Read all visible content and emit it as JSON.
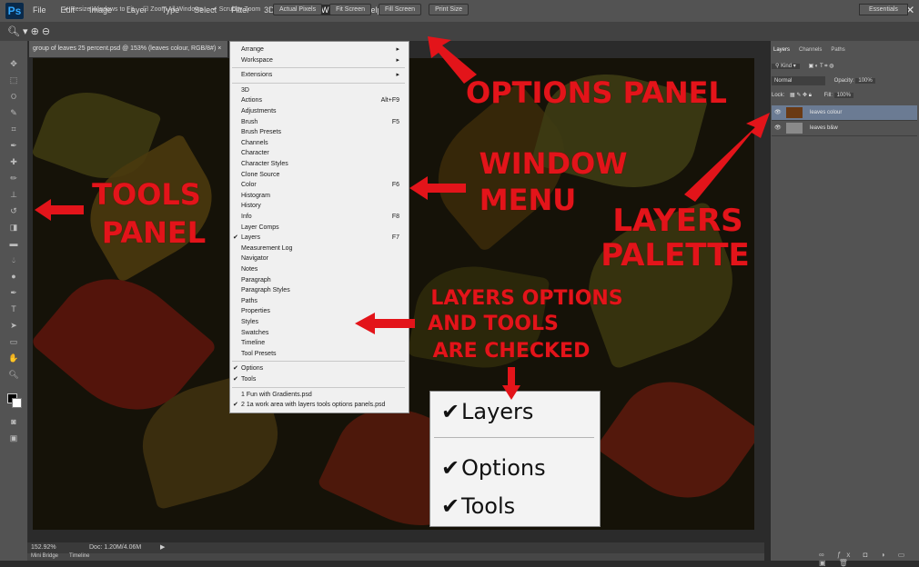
{
  "app": {
    "logo": "Ps",
    "menu": [
      "File",
      "Edit",
      "Image",
      "Layer",
      "Type",
      "Select",
      "Filter",
      "3D",
      "View",
      "Window",
      "Help"
    ],
    "active_menu": "Window",
    "window_controls": [
      "–",
      "⧉",
      "✕"
    ]
  },
  "options_bar": {
    "checks": [
      "Resize Windows to Fit",
      "Zoom All Windows",
      "Scrubby Zoom"
    ],
    "buttons": [
      "Actual Pixels",
      "Fit Screen",
      "Fill Screen",
      "Print Size"
    ],
    "workspace": "Essentials"
  },
  "document": {
    "tab_title": "group of leaves 25 percent.psd @ 153% (leaves colour, RGB/8#) ×",
    "zoom_status": "152.92%",
    "doc_status": "Doc: 1.20M/4.06M",
    "bottom_tabs": [
      "Mini Bridge",
      "Timeline"
    ]
  },
  "layers_panel": {
    "tabs": [
      "Layers",
      "Channels",
      "Paths"
    ],
    "kind_label": "Kind",
    "blend_mode": "Normal",
    "opacity_label": "Opacity:",
    "opacity_value": "100%",
    "lock_label": "Lock:",
    "fill_label": "Fill:",
    "fill_value": "100%",
    "layers": [
      {
        "name": "leaves colour",
        "selected": true
      },
      {
        "name": "leaves b&w",
        "selected": false
      }
    ]
  },
  "window_menu": {
    "items": [
      {
        "label": "Arrange",
        "submenu": true
      },
      {
        "label": "Workspace",
        "submenu": true
      },
      {
        "sep": true
      },
      {
        "label": "Extensions",
        "submenu": true
      },
      {
        "sep": true
      },
      {
        "label": "3D"
      },
      {
        "label": "Actions",
        "shortcut": "Alt+F9"
      },
      {
        "label": "Adjustments"
      },
      {
        "label": "Brush",
        "shortcut": "F5"
      },
      {
        "label": "Brush Presets"
      },
      {
        "label": "Channels"
      },
      {
        "label": "Character"
      },
      {
        "label": "Character Styles"
      },
      {
        "label": "Clone Source"
      },
      {
        "label": "Color",
        "shortcut": "F6"
      },
      {
        "label": "Histogram"
      },
      {
        "label": "History"
      },
      {
        "label": "Info",
        "shortcut": "F8"
      },
      {
        "label": "Layer Comps"
      },
      {
        "label": "Layers",
        "shortcut": "F7",
        "checked": true
      },
      {
        "label": "Measurement Log"
      },
      {
        "label": "Navigator"
      },
      {
        "label": "Notes"
      },
      {
        "label": "Paragraph"
      },
      {
        "label": "Paragraph Styles"
      },
      {
        "label": "Paths"
      },
      {
        "label": "Properties"
      },
      {
        "label": "Styles"
      },
      {
        "label": "Swatches"
      },
      {
        "label": "Timeline"
      },
      {
        "label": "Tool Presets"
      },
      {
        "sep": true
      },
      {
        "label": "Options",
        "checked": true
      },
      {
        "label": "Tools",
        "checked": true
      },
      {
        "sep": true
      },
      {
        "label": "1 Fun with Gradients.psd"
      },
      {
        "label": "2 1a work area with layers tools options panels.psd",
        "checked": true
      }
    ]
  },
  "zoom_inset": {
    "items": [
      "Layers",
      "Options",
      "Tools"
    ]
  },
  "annotations": {
    "options_panel": "OPTIONS PANEL",
    "window_menu_1": "WINDOW",
    "window_menu_2": "MENU",
    "tools_panel_1": "TOOLS",
    "tools_panel_2": "PANEL",
    "layers_palette_1": "LAYERS",
    "layers_palette_2": "PALETTE",
    "checked_1": "LAYERS OPTIONS",
    "checked_2": "AND TOOLS",
    "checked_3": "ARE CHECKED",
    "color": "#e3141a"
  }
}
